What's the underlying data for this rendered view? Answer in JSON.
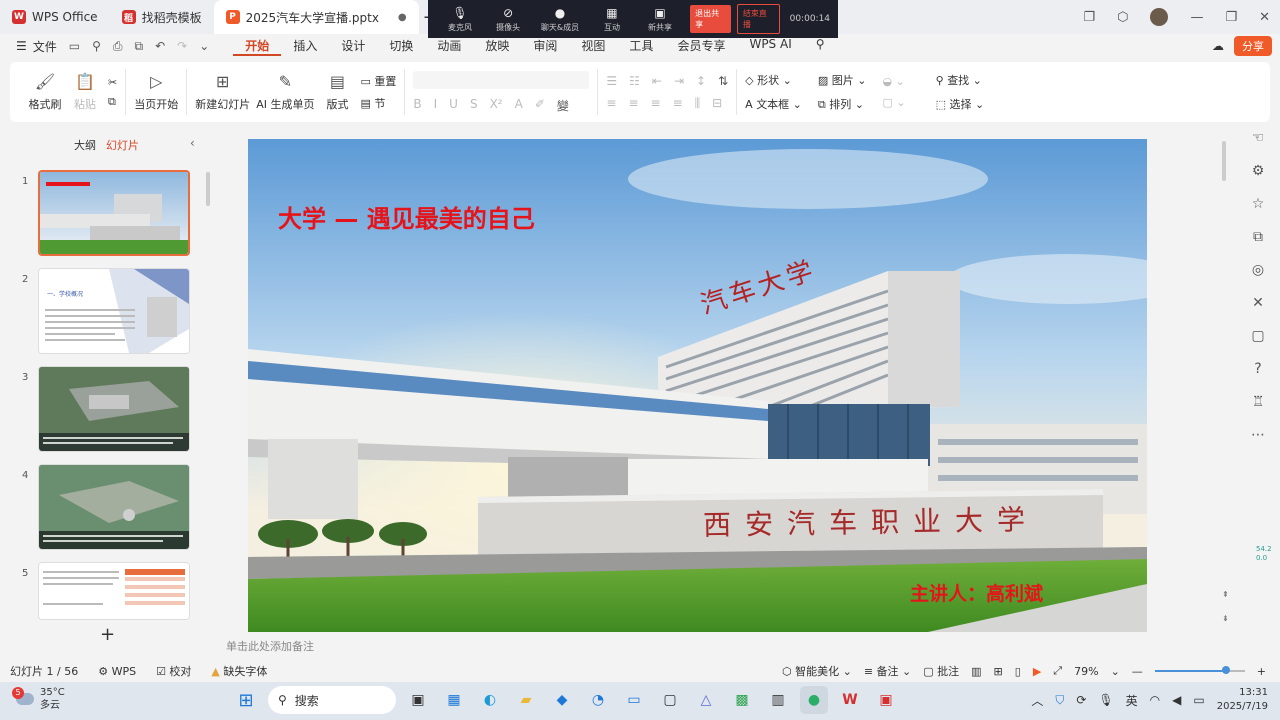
{
  "tabs": [
    {
      "label": "WPS Office",
      "logo_color": "#d3302f"
    },
    {
      "label": "找稻壳模板",
      "logo_color": "#d3302f"
    },
    {
      "label": "2025汽车大学宣播.pptx",
      "logo_color": "#f05a28"
    }
  ],
  "meeting": {
    "items": [
      {
        "label": "麦克风",
        "icon": "mic-icon"
      },
      {
        "label": "摄像头",
        "icon": "camera-off-icon"
      },
      {
        "label": "聊天&成员",
        "icon": "people-icon"
      },
      {
        "label": "互动",
        "icon": "grid-icon"
      },
      {
        "label": "新共享",
        "icon": "share-screen-icon"
      }
    ],
    "stop_share": "退出共享",
    "end_live": "结束直播",
    "timer": "00:00:14"
  },
  "menu": {
    "file": "文件",
    "tabs": [
      "开始",
      "插入",
      "设计",
      "切换",
      "动画",
      "放映",
      "审阅",
      "视图",
      "工具",
      "会员专享",
      "WPS AI"
    ],
    "share": "分享"
  },
  "ribbon": {
    "format_brush": "格式刷",
    "paste": "粘贴",
    "from_current": "当页开始",
    "new_slide": "新建幻灯片",
    "ai_single": "AI 生成单页",
    "layout": "版式",
    "reset": "重置",
    "section": "节",
    "shape": "形状",
    "picture": "图片",
    "textbox": "文本框",
    "arrange": "排列",
    "find": "查找",
    "select": "选择"
  },
  "left_panel": {
    "tab_outline": "大纲",
    "tab_slides": "幻灯片",
    "slides": [
      "1",
      "2",
      "3",
      "4",
      "5"
    ],
    "thumb2_title": "一、学校概况"
  },
  "slide": {
    "title": "大学 — 遇见最美的自己",
    "presenter": "主讲人：高利斌",
    "sign_text": "西安汽车职业大学",
    "roof_text": "汽车大学"
  },
  "notes_placeholder": "单击此处添加备注",
  "statusbar": {
    "slide_count": "幻灯片 1 / 56",
    "wps": "WPS",
    "proof": "校对",
    "missing_font": "缺失字体",
    "smart_beautify": "智能美化",
    "notes": "备注",
    "comments": "批注",
    "zoom": "79%",
    "zoom_fraction": 0.79
  },
  "side_perf": {
    "line1": "54.2",
    "line2": "0.0"
  },
  "taskbar": {
    "temp": "35°C",
    "weather": "多云",
    "weather_badge": "5",
    "search": "搜索",
    "lang": "英",
    "time": "13:31",
    "date": "2025/7/19"
  }
}
